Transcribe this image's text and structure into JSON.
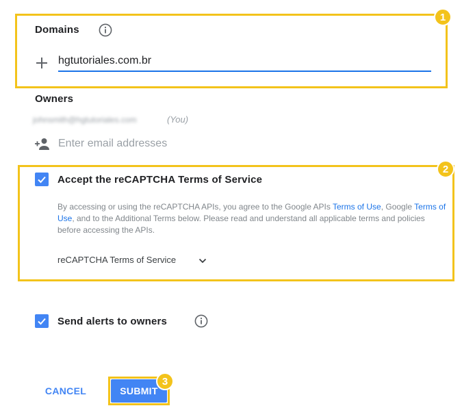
{
  "domains": {
    "title": "Domains",
    "input_value": "hgtutoriales.com.br",
    "add_icon": "plus-icon",
    "info_icon": "info-icon"
  },
  "owners": {
    "title": "Owners",
    "owner_email": "johnsmith@hgtutoriales.com",
    "owner_tag": "(You)",
    "add_icon": "person-add-icon",
    "email_placeholder": "Enter email addresses"
  },
  "terms": {
    "checked": true,
    "label": "Accept the reCAPTCHA Terms of Service",
    "text_part1": "By accessing or using the reCAPTCHA APIs, you agree to the Google APIs ",
    "link1": "Terms of Use",
    "text_part2": ", Google ",
    "link2": "Terms of Use",
    "text_part3": ", and to the Additional Terms below. Please read and understand all applicable terms and policies before accessing the APIs.",
    "dropdown_label": "reCAPTCHA Terms of Service",
    "dropdown_icon": "chevron-down-icon"
  },
  "alerts": {
    "checked": true,
    "label": "Send alerts to owners",
    "info_icon": "info-icon"
  },
  "actions": {
    "cancel_label": "CANCEL",
    "submit_label": "SUBMIT"
  },
  "highlights": {
    "color": "#f3c31b",
    "badges": [
      "1",
      "2",
      "3"
    ]
  },
  "colors": {
    "accent": "#4285f4",
    "input_underline": "#1a73e8",
    "link": "#1a73e8"
  }
}
